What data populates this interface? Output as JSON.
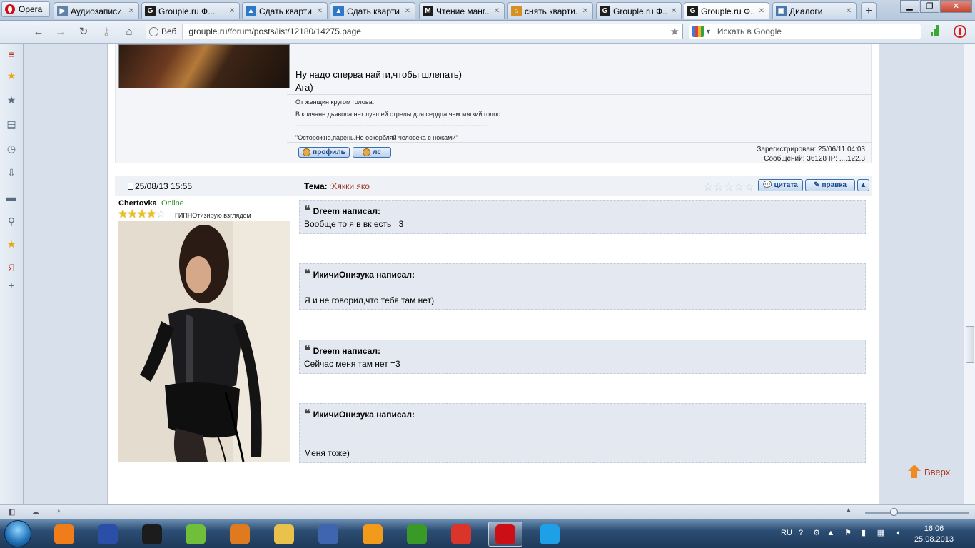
{
  "browser": {
    "menu_label": "Opera",
    "tabs": [
      {
        "label": "Аудиозаписи...",
        "favicon_color": "#5f82a8",
        "favicon_text": "▶"
      },
      {
        "label": "Grouple.ru Ф...",
        "favicon_color": "#1d1d1d",
        "favicon_text": "G"
      },
      {
        "label": "Сдать кварти...",
        "favicon_color": "#2f78c8",
        "favicon_text": "▲"
      },
      {
        "label": "Сдать кварти...",
        "favicon_color": "#2f78c8",
        "favicon_text": "▲"
      },
      {
        "label": "Чтение манг...",
        "favicon_color": "#1d1d1d",
        "favicon_text": "M"
      },
      {
        "label": "снять кварти...",
        "favicon_color": "#d69022",
        "favicon_text": "⌂"
      },
      {
        "label": "Grouple.ru Ф...",
        "favicon_color": "#1d1d1d",
        "favicon_text": "G"
      },
      {
        "label": "Grouple.ru Ф...",
        "favicon_color": "#1d1d1d",
        "favicon_text": "G"
      },
      {
        "label": "Диалоги",
        "favicon_color": "#4a76a8",
        "favicon_text": "▣"
      }
    ],
    "close_glyph": "✕",
    "new_tab_glyph": "+",
    "address": {
      "badge": "Веб",
      "url": "grouple.ru/forum/posts/list/12180/14275.page"
    },
    "search": {
      "placeholder": "Искать в Google"
    },
    "accent_color": "#cc0f16"
  },
  "previous_post": {
    "text_lines": [
      "Ну надо сперва найти,чтобы шлепать)",
      "Ага)"
    ],
    "signature_lines": [
      "От женщин кругом голова.",
      "В колчане дьявола нет лучшей стрелы для сердца,чем мягкий голос.",
      "------------------------------------------------------------------------------------------",
      "\"Осторожно,парень.Не оскорбляй человека с ножами\""
    ],
    "profile_btn": "профиль",
    "pm_btn": "лс",
    "registered": "Зарегистрирован: 25/06/11 04:03",
    "messages": "Сообщений: 36128 IP: ....122.3"
  },
  "post": {
    "date": "25/08/13 15:55",
    "topic_label": "Тема:",
    "topic_value": ":Хякки яко",
    "quote_btn": "цитата",
    "edit_btn": "правка",
    "author": {
      "name": "Chertovka",
      "online": "Online",
      "rank_stars_on": 4,
      "rank_stars_total": 5,
      "status": "ГИПНОтизирую взглядом"
    },
    "quotes": [
      {
        "author": "Dreem написал:",
        "text": "Вообще то я в вк есть =3"
      },
      {
        "author": "ИкичиОнизука написал:",
        "text": "Я и не говорил,что тебя там нет)"
      },
      {
        "author": "Dreem написал:",
        "text": "Сейчас меня там нет =3"
      },
      {
        "author": "ИкичиОнизука написал:",
        "text": "Меня тоже)"
      }
    ]
  },
  "back_link": "Вверх",
  "taskbar": {
    "language": "RU",
    "time": "16:06",
    "date": "25.08.2013",
    "apps": [
      {
        "name": "avast",
        "color": "#f07c1a",
        "active": false
      },
      {
        "name": "save",
        "color": "#2b4fa8",
        "active": false
      },
      {
        "name": "hp",
        "color": "#1c1c1c",
        "active": false
      },
      {
        "name": "flask",
        "color": "#6fbf3a",
        "active": false
      },
      {
        "name": "media",
        "color": "#e07a1e",
        "active": false
      },
      {
        "name": "explorer",
        "color": "#e8c24a",
        "active": false
      },
      {
        "name": "paint",
        "color": "#3f64b0",
        "active": false
      },
      {
        "name": "link",
        "color": "#f29a1a",
        "active": false
      },
      {
        "name": "utorrent",
        "color": "#3a9a28",
        "active": false
      },
      {
        "name": "chrome",
        "color": "#d9352a",
        "active": false
      },
      {
        "name": "opera",
        "color": "#cc0f16",
        "active": true
      },
      {
        "name": "skype",
        "color": "#1ea0e6",
        "active": false
      }
    ]
  }
}
